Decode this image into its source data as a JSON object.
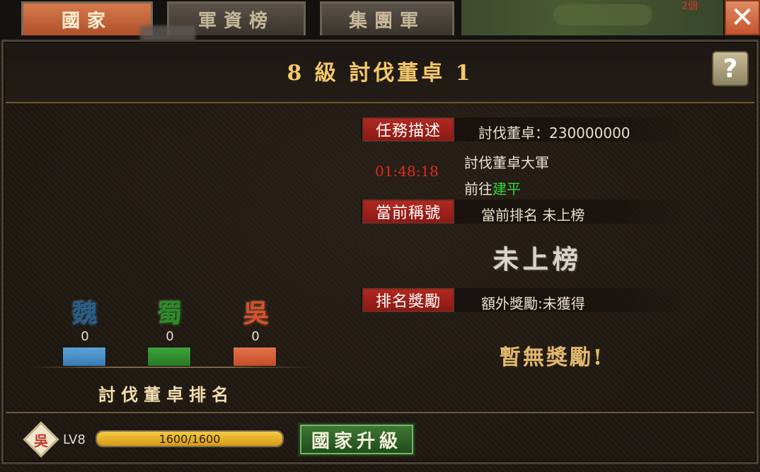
{
  "tabs": [
    {
      "label": "國家",
      "active": true
    },
    {
      "label": "軍資榜",
      "active": false
    },
    {
      "label": "集團軍",
      "active": false
    }
  ],
  "map_peek_text": "2個",
  "close_icon": "close-icon",
  "help_icon": "help-icon",
  "title": "8 級  討伐董卓 1",
  "mission": {
    "label": "任務描述",
    "desc": "討伐董卓：230000000",
    "timer": "01:48:18",
    "army": "討伐董卓大軍",
    "goto_prefix": "前往",
    "goto_place": "建平"
  },
  "title_row": {
    "label": "當前稱號",
    "text": "當前排名 未上榜",
    "big": "未上榜"
  },
  "reward_row": {
    "label": "排名獎勵",
    "text": "額外獎勵:未獲得",
    "none": "暫無獎勵!"
  },
  "kingdoms": [
    {
      "name": "魏",
      "count": "0",
      "color": "#3a7bb4"
    },
    {
      "name": "蜀",
      "count": "0",
      "color": "#267a23"
    },
    {
      "name": "吳",
      "count": "0",
      "color": "#c24e28"
    }
  ],
  "ranking_title": "討伐董卓排名",
  "player": {
    "emblem": "吳",
    "level": "LV8",
    "exp_text": "1600/1600",
    "exp_fraction": 1.0
  },
  "upgrade_button": "國家升級"
}
